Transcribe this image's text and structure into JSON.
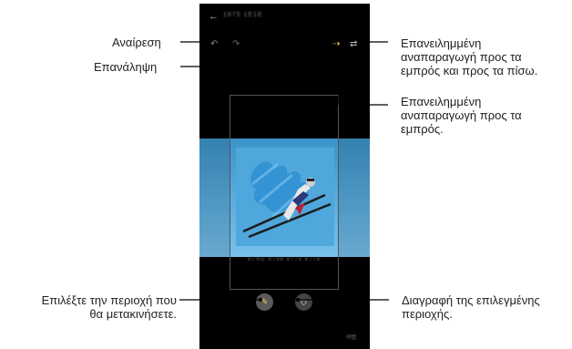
{
  "phone": {
    "status_title": "1875 1E1E",
    "caption": "87%E 8798 8779 8774",
    "done_label": "어범",
    "toolbar": {
      "undo_icon": "↶",
      "redo_icon": "↷",
      "repeat_forward_icon": "⇢",
      "repeat_loop_icon": "⇄",
      "back_icon": "←"
    },
    "buttons": {
      "select_area_icon": "✎",
      "erase_area_icon": "◇"
    }
  },
  "callouts": {
    "undo": "Αναίρεση",
    "redo": "Επανάληψη",
    "repeat_loop": [
      "Επανειλημμένη",
      "αναπαραγωγή προς τα",
      "εμπρός και προς τα πίσω."
    ],
    "repeat_forward": [
      "Επανειλημμένη",
      "αναπαραγωγή προς τα",
      "εμπρός."
    ],
    "select_area": [
      "Επιλέξτε την περιοχή που",
      "θα μετακινήσετε."
    ],
    "erase_area": [
      "Διαγραφή της επιλεγμένης",
      "περιοχής."
    ]
  },
  "colors": {
    "sky_band": "#5aaee0",
    "highlight": "#f2d14a",
    "phone_background": "#000000"
  }
}
